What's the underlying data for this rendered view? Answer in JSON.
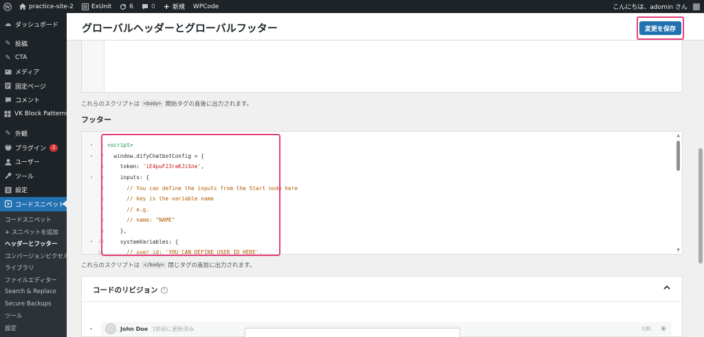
{
  "adminbar": {
    "site_name": "practice-site-2",
    "exunit": "ExUnit",
    "updates_count": "6",
    "comments_count": "0",
    "new_label": "新規",
    "wpcode": "WPCode",
    "greeting": "こんにちは、adomin さん"
  },
  "sidebar": {
    "items": [
      {
        "label": "ダッシュボード",
        "icon": "dashboard-icon"
      },
      {
        "label": "投稿",
        "icon": "pin-icon"
      },
      {
        "label": "CTA",
        "icon": "pin-icon"
      },
      {
        "label": "メディア",
        "icon": "media-icon"
      },
      {
        "label": "固定ページ",
        "icon": "page-icon"
      },
      {
        "label": "コメント",
        "icon": "comment-icon"
      },
      {
        "label": "VK Block Patterns",
        "icon": "grid-icon"
      },
      {
        "label": "外観",
        "icon": "brush-icon"
      },
      {
        "label": "プラグイン",
        "icon": "plugin-icon",
        "badge": "2"
      },
      {
        "label": "ユーザー",
        "icon": "user-icon"
      },
      {
        "label": "ツール",
        "icon": "wrench-icon"
      },
      {
        "label": "設定",
        "icon": "settings-icon"
      },
      {
        "label": "コードスニペット",
        "icon": "code-icon"
      }
    ],
    "submenu": [
      "コードスニペット",
      "+ スニペットを追加",
      "ヘッダーとフッター",
      "コンバージョンピクセル",
      "ライブラリ",
      "ファイルエディター",
      "Search & Replace",
      "Secure Backups",
      "ツール",
      "設定"
    ]
  },
  "header": {
    "title": "グローバルヘッダーとグローバルフッター",
    "save_label": "変更を保存"
  },
  "body_desc": {
    "before": "これらのスクリプトは",
    "chip": "<body>",
    "after": "開始タグの直後に出力されます。"
  },
  "footer_section": {
    "title": "フッター"
  },
  "code": {
    "lines": [
      {
        "num": "1",
        "fold": "▾",
        "text": "<script>",
        "kind": "tag"
      },
      {
        "num": "2",
        "fold": "▾",
        "text": "  window.difyChatbotConfig = {",
        "kind": "plain"
      },
      {
        "num": "3",
        "fold": "",
        "pre": "    token: ",
        "str": "'iE4puF23raKJiSne'",
        "post": ",",
        "kind": "mixed"
      },
      {
        "num": "4",
        "fold": "▾",
        "text": "    inputs: {",
        "kind": "plain"
      },
      {
        "num": "5",
        "fold": "",
        "text": "      // You can define the inputs from the Start node here",
        "kind": "comment"
      },
      {
        "num": "6",
        "fold": "",
        "text": "      // key is the variable name",
        "kind": "comment"
      },
      {
        "num": "7",
        "fold": "",
        "text": "      // e.g.",
        "kind": "comment"
      },
      {
        "num": "8",
        "fold": "",
        "text": "      // name: \"NAME\"",
        "kind": "comment"
      },
      {
        "num": "9",
        "fold": "",
        "text": "    },",
        "kind": "plain"
      },
      {
        "num": "10",
        "fold": "▾",
        "text": "    systemVariables: {",
        "kind": "plain"
      },
      {
        "num": "11",
        "fold": "",
        "text": "      // user_id: 'YOU CAN DEFINE USER ID HERE',",
        "kind": "comment"
      }
    ]
  },
  "footer_desc": {
    "before": "これらのスクリプトは",
    "chip": "</body>",
    "after": "閉じタグの直前に出力されます。"
  },
  "revisions": {
    "title": "コードのリビジョン",
    "author": "John Doe",
    "time": "1秒前に更新済み",
    "compare": "比較"
  },
  "colors": {
    "accent": "#2271b1",
    "highlight": "#e63c7a",
    "badge": "#d63638"
  }
}
